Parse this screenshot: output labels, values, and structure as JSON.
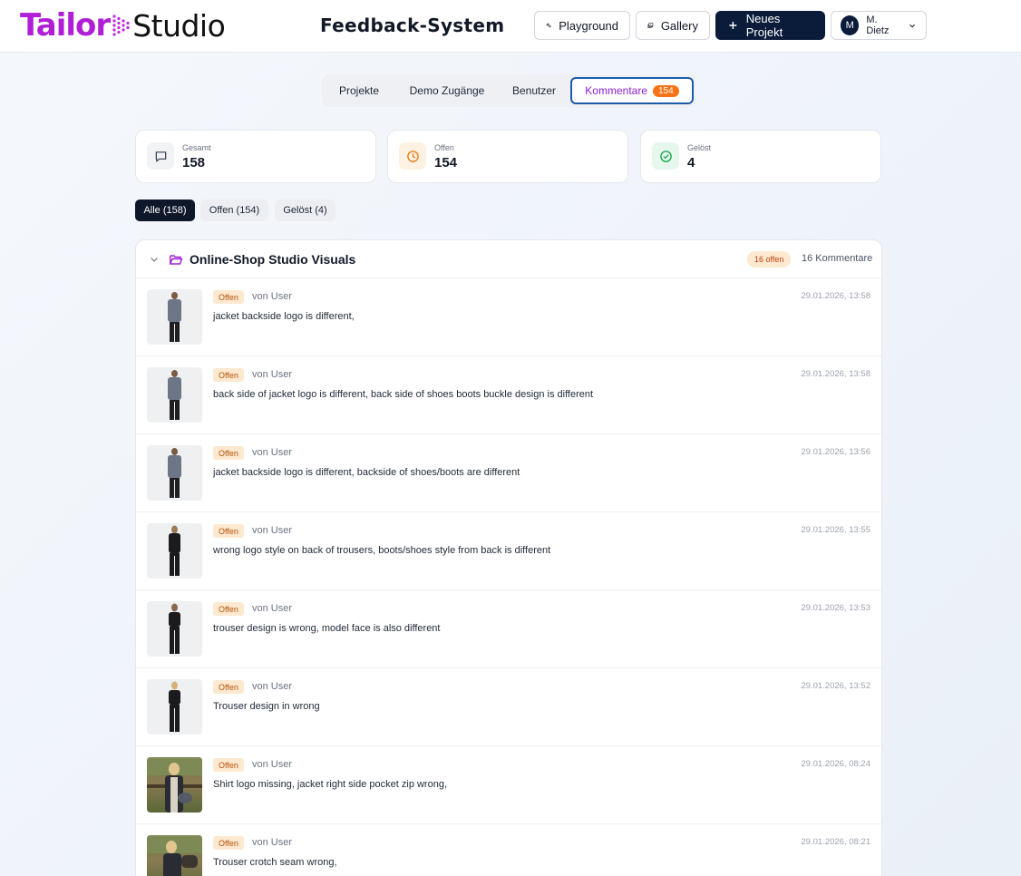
{
  "brand": {
    "part1": "Tailor",
    "part2": "Studio",
    "accent": "#b01ed6"
  },
  "header": {
    "title": "Feedback-System",
    "playground_label": "Playground",
    "gallery_label": "Gallery",
    "new_project_label": "Neues Projekt",
    "user_initial": "M",
    "user_name": "M. Dietz"
  },
  "tabs": {
    "projekte": "Projekte",
    "demo": "Demo Zugänge",
    "benutzer": "Benutzer",
    "kommentare": "Kommentare",
    "kommentare_count": "154"
  },
  "stats": [
    {
      "label": "Gesamt",
      "value": "158",
      "icon": "message-icon"
    },
    {
      "label": "Offen",
      "value": "154",
      "icon": "clock-icon"
    },
    {
      "label": "Gelöst",
      "value": "4",
      "icon": "check-circle-icon"
    }
  ],
  "filters": {
    "alle": "Alle (158)",
    "offen": "Offen (154)",
    "geloest": "Gelöst (4)"
  },
  "project": {
    "title": "Online-Shop Studio Visuals",
    "open_badge": "16 offen",
    "count": "16 Kommentare"
  },
  "comments": [
    {
      "status": "Offen",
      "author": "von User",
      "text": "jacket backside logo is different,",
      "date": "29.01.2026, 13:58"
    },
    {
      "status": "Offen",
      "author": "von User",
      "text": "back side of jacket logo is different, back side of shoes boots buckle design is different",
      "date": "29.01.2026, 13:58"
    },
    {
      "status": "Offen",
      "author": "von User",
      "text": "jacket backside logo is different, backside of shoes/boots are different",
      "date": "29.01.2026, 13:56"
    },
    {
      "status": "Offen",
      "author": "von User",
      "text": "wrong logo style on back of trousers, boots/shoes style from back is different",
      "date": "29.01.2026, 13:55"
    },
    {
      "status": "Offen",
      "author": "von User",
      "text": "trouser design is wrong, model face is also different",
      "date": "29.01.2026, 13:53"
    },
    {
      "status": "Offen",
      "author": "von User",
      "text": "Trouser design in wrong",
      "date": "29.01.2026, 13:52"
    },
    {
      "status": "Offen",
      "author": "von User",
      "text": "Shirt logo missing, jacket right side pocket zip wrong,",
      "date": "29.01.2026, 08:24"
    },
    {
      "status": "Offen",
      "author": "von User",
      "text": "Trouser crotch seam wrong,",
      "date": "29.01.2026, 08:21"
    }
  ]
}
